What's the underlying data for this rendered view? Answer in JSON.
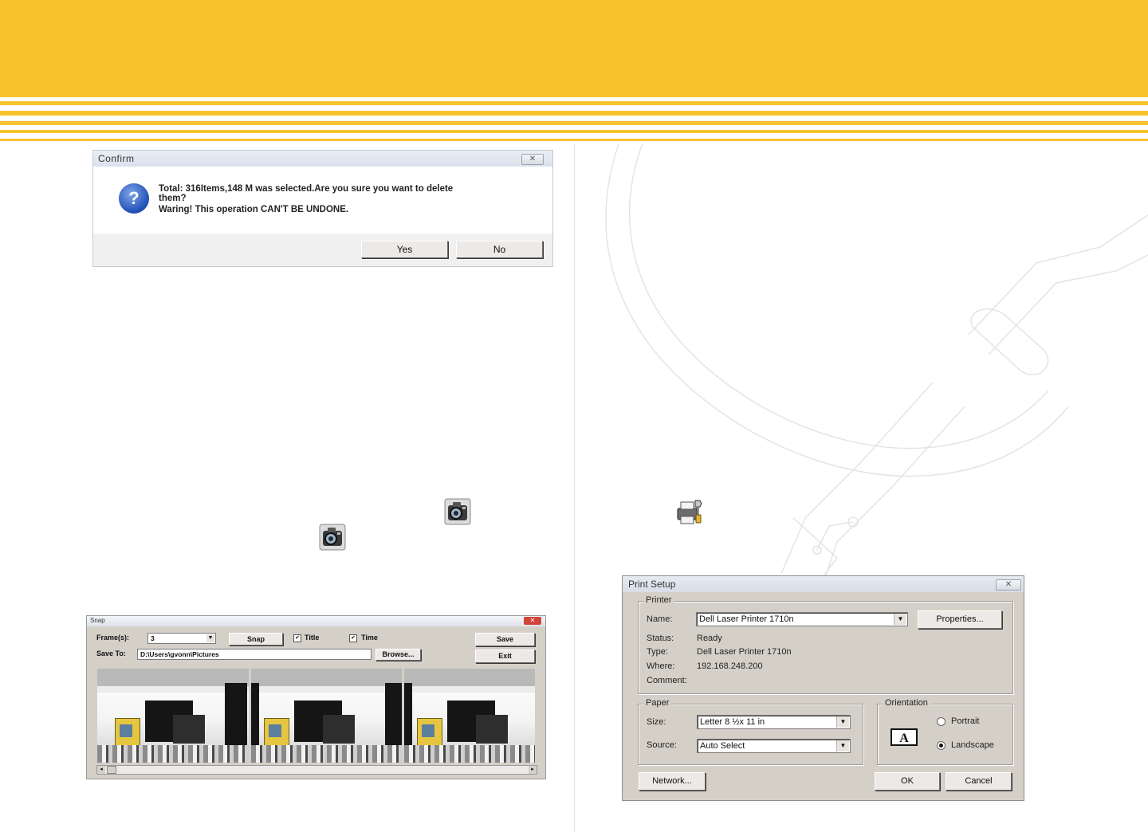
{
  "confirm_dialog": {
    "title": "Confirm",
    "close_glyph": "✕",
    "icon": "question-icon",
    "message_line1": "Total: 316Items,148 M was selected.Are you sure you want to delete",
    "message_line2": "them?",
    "message_line3": "Waring! This operation CAN'T BE UNDONE.",
    "yes_label": "Yes",
    "no_label": "No"
  },
  "inline_icons": {
    "snapshot_icon_1": "camera-icon",
    "snapshot_icon_2": "camera-icon",
    "print_setup_icon": "printer-settings-icon"
  },
  "snap_dialog": {
    "title": "Snap",
    "close_glyph": "✕",
    "frames_label": "Frame(s):",
    "frames_value": "3",
    "snap_button": "Snap",
    "title_checkbox": "Title",
    "title_checked": true,
    "time_checkbox": "Time",
    "time_checked": true,
    "save_button": "Save",
    "save_to_label": "Save To:",
    "save_to_value": "D:\\Users\\gvonn\\Pictures",
    "browse_button": "Browse...",
    "exit_button": "Exit",
    "frame_count": 3,
    "scroll_left": "◂",
    "scroll_right": "▸"
  },
  "print_setup": {
    "title": "Print Setup",
    "close_glyph": "✕",
    "printer_group": "Printer",
    "name_label": "Name:",
    "name_value": "Dell Laser Printer 1710n",
    "properties_button": "Properties...",
    "status_label": "Status:",
    "status_value": "Ready",
    "type_label": "Type:",
    "type_value": "Dell Laser Printer 1710n",
    "where_label": "Where:",
    "where_value": "192.168.248.200",
    "comment_label": "Comment:",
    "comment_value": "",
    "paper_group": "Paper",
    "size_label": "Size:",
    "size_value": "Letter 8 ½x 11 in",
    "source_label": "Source:",
    "source_value": "Auto Select",
    "orientation_group": "Orientation",
    "orientation_icon_letter": "A",
    "portrait_label": "Portrait",
    "landscape_label": "Landscape",
    "selected_orientation": "Landscape",
    "network_button": "Network...",
    "ok_button": "OK",
    "cancel_button": "Cancel",
    "dropdown_glyph": "▼"
  },
  "colors": {
    "header_yellow": "#f8c22c",
    "dialog_gray": "#d4d0c8",
    "question_blue": "#1f4fb5"
  }
}
